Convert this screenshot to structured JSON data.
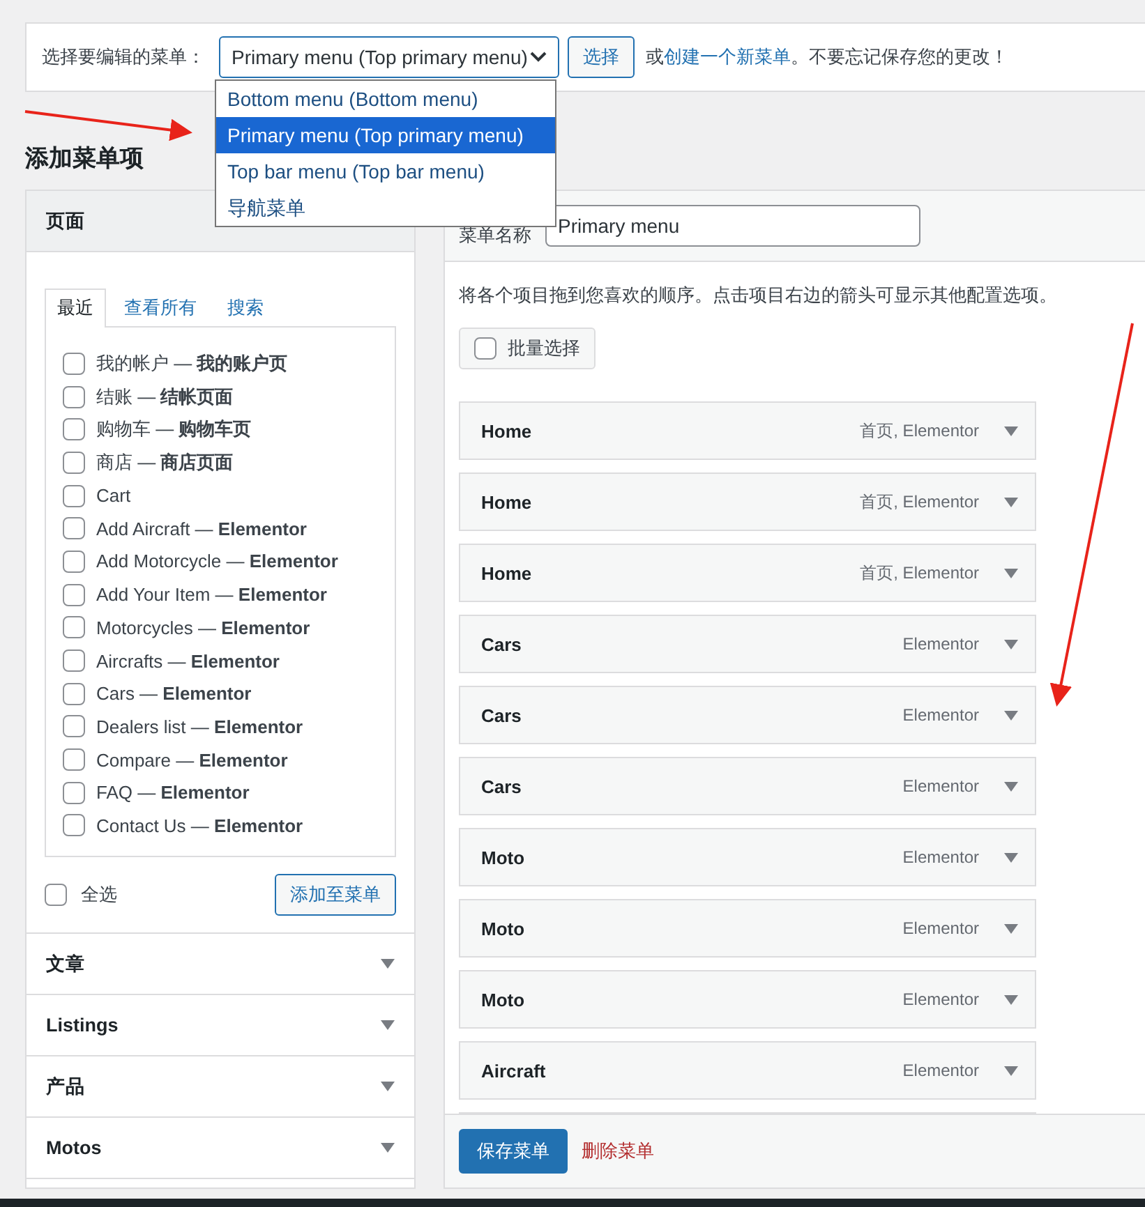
{
  "menu_select": {
    "label": "选择要编辑的菜单：",
    "value": "Primary menu (Top primary menu)",
    "expanded": true,
    "options": [
      {
        "label": "Bottom menu (Bottom menu)",
        "selected": false
      },
      {
        "label": "Primary menu (Top primary menu)",
        "selected": true
      },
      {
        "label": "Top bar menu (Top bar menu)",
        "selected": false
      },
      {
        "label": "导航菜单",
        "selected": false
      }
    ],
    "button": "选择",
    "note_prefix": "或",
    "note_link": "创建一个新菜单",
    "note_suffix": "。不要忘记保存您的更改！"
  },
  "add_items_heading": "添加菜单项",
  "sections": [
    {
      "title": "页面",
      "expanded": true
    },
    {
      "title": "文章",
      "expanded": false
    },
    {
      "title": "Listings",
      "expanded": false
    },
    {
      "title": "产品",
      "expanded": false
    },
    {
      "title": "Motos",
      "expanded": false
    }
  ],
  "page_tabs": [
    {
      "label": "最近",
      "selected": true
    },
    {
      "label": "查看所有",
      "selected": false
    },
    {
      "label": "搜索",
      "selected": false
    }
  ],
  "pages": [
    {
      "label": "我的帐户 — **我的账户页**",
      "checked": false
    },
    {
      "label": "结账 — **结帐页面**",
      "checked": false
    },
    {
      "label": "购物车 — **购物车页**",
      "checked": false
    },
    {
      "label": "商店 — **商店页面**",
      "checked": false
    },
    {
      "label": "Cart",
      "checked": false
    },
    {
      "label": "Add Aircraft — **Elementor**",
      "checked": false
    },
    {
      "label": "Add Motorcycle — **Elementor**",
      "checked": false
    },
    {
      "label": "Add Your Item — **Elementor**",
      "checked": false
    },
    {
      "label": "Motorcycles — **Elementor**",
      "checked": false
    },
    {
      "label": "Aircrafts — **Elementor**",
      "checked": false
    },
    {
      "label": "Cars — **Elementor**",
      "checked": false
    },
    {
      "label": "Dealers list — **Elementor**",
      "checked": false
    },
    {
      "label": "Compare — **Elementor**",
      "checked": false
    },
    {
      "label": "FAQ — **Elementor**",
      "checked": false
    },
    {
      "label": "Contact Us — **Elementor**",
      "checked": false
    }
  ],
  "select_all": {
    "label": "全选",
    "checked": false
  },
  "add_to_menu_button": "添加至菜单",
  "menu_name": {
    "label": "菜单名称",
    "value": "Primary menu"
  },
  "instructions": "将各个项目拖到您喜欢的顺序。点击项目右边的箭头可显示其他配置选项。",
  "bulk_select": {
    "label": "批量选择",
    "checked": false
  },
  "menu_items": [
    {
      "title": "Home",
      "type": "首页, Elementor"
    },
    {
      "title": "Home",
      "type": "首页, Elementor"
    },
    {
      "title": "Home",
      "type": "首页, Elementor"
    },
    {
      "title": "Cars",
      "type": "Elementor"
    },
    {
      "title": "Cars",
      "type": "Elementor"
    },
    {
      "title": "Cars",
      "type": "Elementor"
    },
    {
      "title": "Moto",
      "type": "Elementor"
    },
    {
      "title": "Moto",
      "type": "Elementor"
    },
    {
      "title": "Moto",
      "type": "Elementor"
    },
    {
      "title": "Aircraft",
      "type": "Elementor"
    }
  ],
  "save_button": "保存菜单",
  "delete_link": "删除菜单"
}
